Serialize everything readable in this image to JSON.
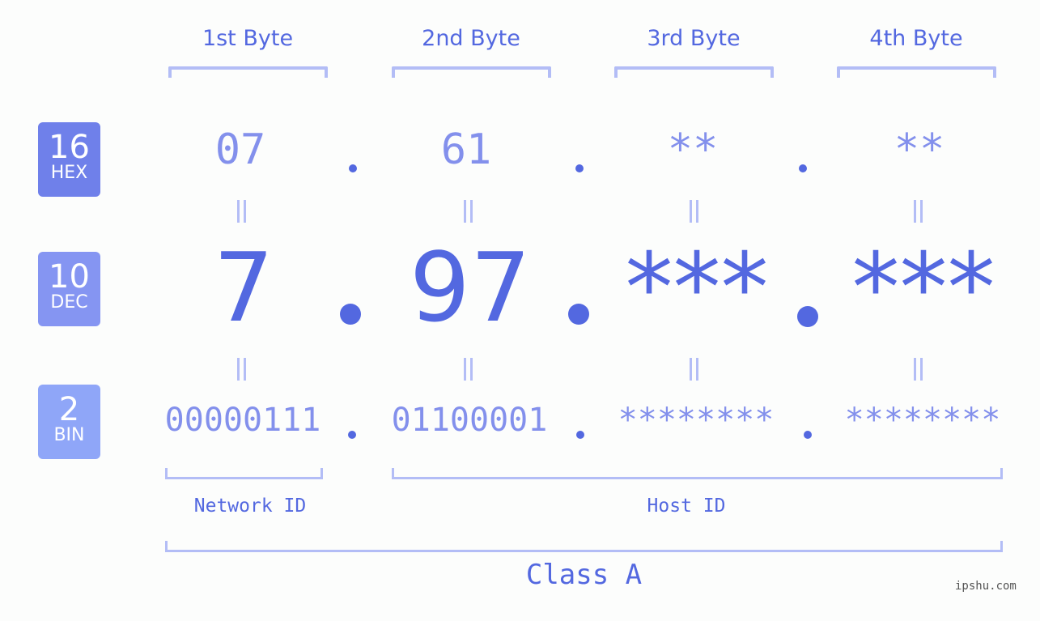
{
  "bytes": {
    "headers": [
      "1st Byte",
      "2nd Byte",
      "3rd Byte",
      "4th Byte"
    ],
    "hex": [
      "07",
      "61",
      "**",
      "**"
    ],
    "dec": [
      "7",
      "97",
      "***",
      "***"
    ],
    "bin": [
      "00000111",
      "01100001",
      "********",
      "********"
    ]
  },
  "badges": {
    "hex": {
      "num": "16",
      "label": "HEX",
      "color": "#6f80ea"
    },
    "dec": {
      "num": "10",
      "label": "DEC",
      "color": "#8595f2"
    },
    "bin": {
      "num": "2",
      "label": "BIN",
      "color": "#8fa6f8"
    }
  },
  "labels": {
    "network_id": "Network ID",
    "host_id": "Host ID",
    "class": "Class A"
  },
  "watermark": "ipshu.com",
  "colors": {
    "accent": "#5368e0",
    "light_text": "#8390ec",
    "bracket": "#b3bdf6"
  }
}
